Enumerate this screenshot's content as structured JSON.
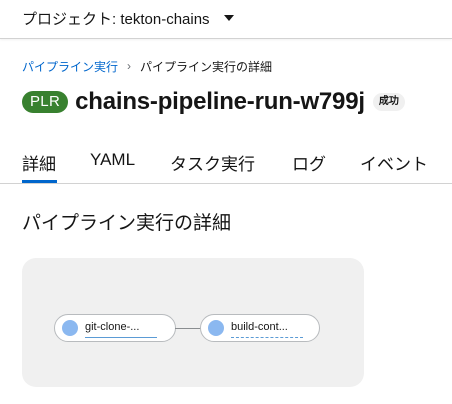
{
  "header": {
    "project_label": "プロジェクト: tekton-chains"
  },
  "breadcrumb": {
    "parent": "パイプライン実行",
    "separator": "›",
    "current": "パイプライン実行の詳細"
  },
  "title": {
    "badge": "PLR",
    "name": "chains-pipeline-run-w799j",
    "status": "成功"
  },
  "tabs": [
    {
      "label": "詳細",
      "active": true
    },
    {
      "label": "YAML",
      "active": false
    },
    {
      "label": "タスク実行",
      "active": false
    },
    {
      "label": "ログ",
      "active": false
    },
    {
      "label": "イベント",
      "active": false
    }
  ],
  "section": {
    "title": "パイプライン実行の詳細"
  },
  "topology": {
    "tasks": [
      {
        "label": "git-clone-..."
      },
      {
        "label": "build-cont..."
      }
    ]
  },
  "colors": {
    "primary": "#0066cc",
    "success": "#38812f",
    "task_dot": "#8bb8f0"
  },
  "icons": {
    "project_dropdown": "caret-down-icon",
    "breadcrumb_separator": "chevron-right-icon"
  }
}
